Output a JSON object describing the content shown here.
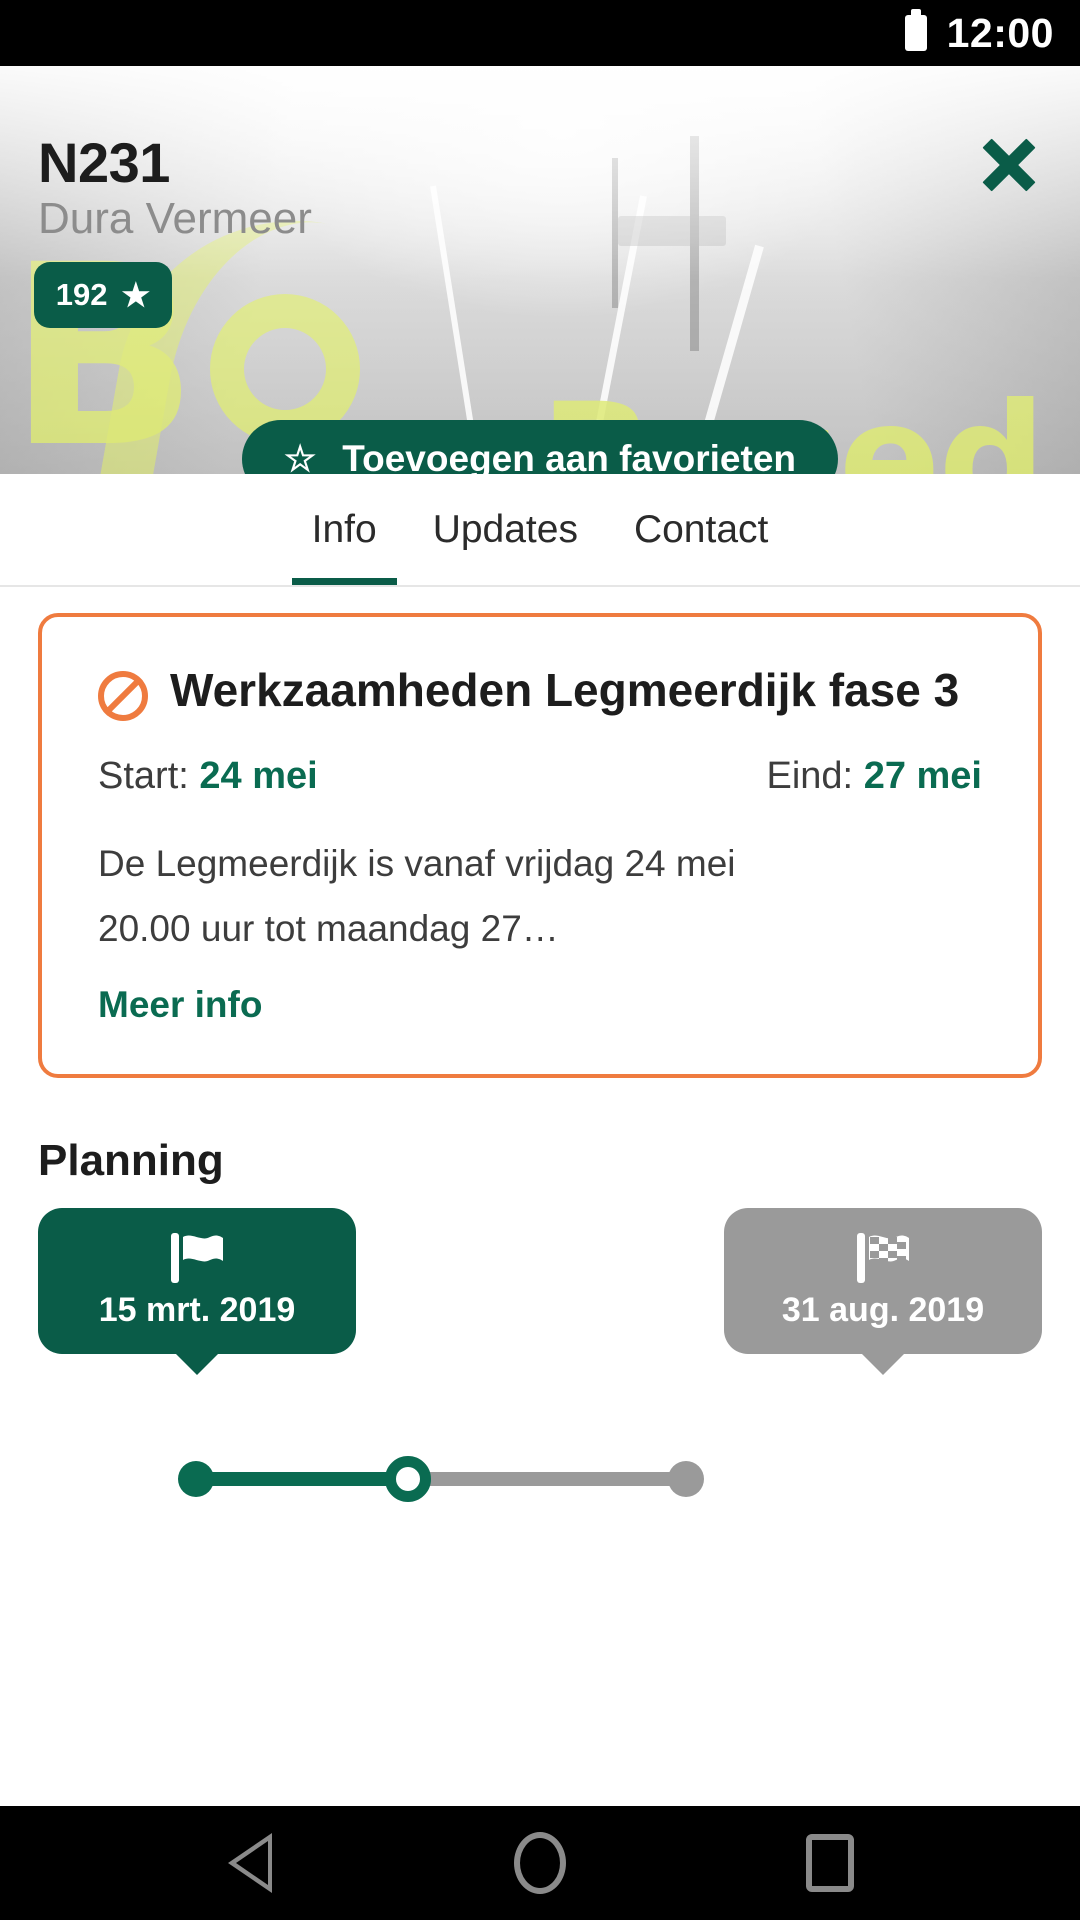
{
  "statusbar": {
    "time": "12:00",
    "battery_icon": "battery-icon"
  },
  "hero": {
    "title": "N231",
    "subtitle": "Dura Vermeer",
    "close_icon": "close-icon",
    "badge": {
      "count": "192",
      "icon": "star-solid-icon",
      "glyph": "★"
    },
    "favorite_button": {
      "label": "Toevoegen aan favorieten",
      "icon": "star-outline-icon",
      "glyph": "☆"
    },
    "logo_letter": "B",
    "logo_word": "Based"
  },
  "tabs": [
    {
      "label": "Info",
      "active": true
    },
    {
      "label": "Updates",
      "active": false
    },
    {
      "label": "Contact",
      "active": false
    }
  ],
  "alert": {
    "icon": "no-entry-icon",
    "title": "Werkzaamheden Legmeerdijk fase 3",
    "start_label": "Start:",
    "start_value": "24 mei",
    "end_label": "Eind:",
    "end_value": "27 mei",
    "description_line1": "De Legmeerdijk is vanaf vrijdag 24 mei",
    "description_line2": "20.00 uur tot maandag 27…",
    "link_label": "Meer info",
    "border_color": "#ef7b3f"
  },
  "planning": {
    "heading": "Planning",
    "milestones": [
      {
        "date": "15 mrt. 2019",
        "icon": "flag-icon",
        "state": "done",
        "color": "#0a5c48"
      },
      {
        "date": "31 aug. 2019",
        "icon": "checkered-flag-icon",
        "state": "upcoming",
        "color": "#9a9a9a"
      }
    ],
    "progress": {
      "value": 44,
      "track_done_color": "#0a6b51",
      "track_todo_color": "#9a9a9a"
    }
  },
  "navbar": {
    "back": "back-icon",
    "home": "home-icon",
    "recents": "recents-icon"
  },
  "theme": {
    "primary_green": "#0a5c48",
    "link_green": "#0a6b51",
    "accent_orange": "#ef7b3f",
    "logo_yellow": "#dbe86a"
  }
}
